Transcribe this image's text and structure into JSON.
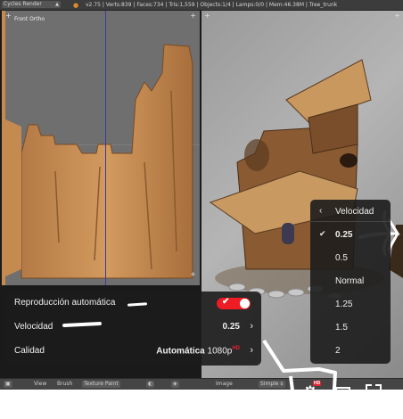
{
  "blender": {
    "render_engine": "Cycles Render",
    "stats": "v2.75 | Verts:839 | Faces:734 | Tris:1,559 | Objects:1/4 | Lamps:0/0 | Mem:46.38M | Tree_trunk",
    "view_name": "Front Ortho",
    "bottom_header": {
      "view": "View",
      "brush": "Brush",
      "texture_paint": "Texture Paint",
      "image": "Image",
      "simple": "Simple s"
    }
  },
  "settings_menu": {
    "autoplay_label": "Reproducción automática",
    "autoplay_on": true,
    "speed_label": "Velocidad",
    "speed_value": "0.25",
    "quality_label": "Calidad",
    "quality_value": "Automática",
    "quality_resolution": "1080p",
    "quality_badge": "HD"
  },
  "speed_menu": {
    "title": "Velocidad",
    "options": [
      "0.25",
      "0.5",
      "Normal",
      "1.25",
      "1.5",
      "2"
    ],
    "selected": "0.25"
  },
  "player": {
    "hd_badge": "HD"
  },
  "icons": [
    "blender-logo-icon",
    "settings-gear-icon",
    "theater-mode-icon",
    "fullscreen-icon",
    "check-icon",
    "chevron-right-icon",
    "chevron-left-icon"
  ],
  "colors": {
    "accent_red": "#ee1c24",
    "menu_bg": "#1c1c1c",
    "annotation": "#ffffff"
  }
}
